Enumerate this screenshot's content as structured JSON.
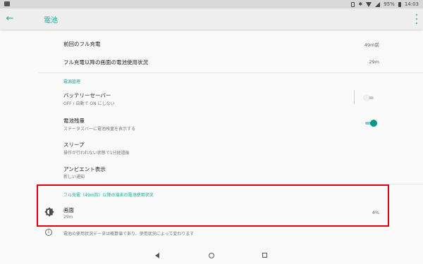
{
  "status_bar": {
    "battery_percent": "95%",
    "time": "14:03",
    "icons": [
      "image-icon",
      "vibrate-icon",
      "bluetooth-icon",
      "wifi-icon",
      "signal-icon",
      "battery-icon"
    ]
  },
  "app_bar": {
    "back_icon": "arrow-left-icon",
    "title": "電池",
    "menu_icon": "more-vert-icon"
  },
  "summary": [
    {
      "label": "前回のフル充電",
      "value": "49m前"
    },
    {
      "label": "フル充電以降の画面の電池使用状況",
      "value": "29m"
    }
  ],
  "power_section": {
    "header": "電源管理",
    "items": [
      {
        "label": "バッテリーセーバー",
        "sub": "OFF / 自動で ON にしない",
        "toggle": "off"
      },
      {
        "label": "電池残量",
        "sub": "ステータスバーに電池残量を表示する",
        "toggle": "on"
      },
      {
        "label": "スリープ",
        "sub": "操作が行われない状態で1分経過後"
      },
      {
        "label": "アンビエント表示",
        "sub": "新しい通知"
      }
    ]
  },
  "usage_section": {
    "header": "フル充電（49m前）以降の端末の電池使用状況",
    "item": {
      "label": "画面",
      "sub": "29m",
      "value": "4%",
      "icon": "brightness-icon"
    }
  },
  "footer_note": "電池の使用状況データは概算値であり、使用状況によって変わります",
  "accent_color": "#26a69a",
  "highlight_color": "#e8000f",
  "nav_bar": {
    "icons": [
      "nav-back-icon",
      "nav-home-icon",
      "nav-recents-icon"
    ]
  }
}
